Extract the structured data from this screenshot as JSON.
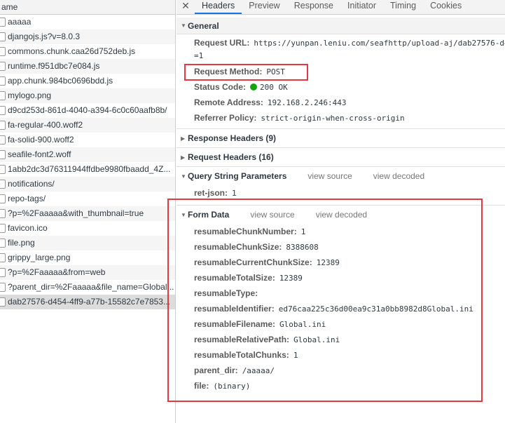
{
  "left": {
    "header": "ame",
    "requests": [
      "aaaaa",
      "djangojs.js?v=8.0.3",
      "commons.chunk.caa26d752deb.js",
      "runtime.f951dbc7e084.js",
      "app.chunk.984bc0696bdd.js",
      "mylogo.png",
      "d9cd253d-861d-4040-a394-6c0c60aafb8b/",
      "fa-regular-400.woff2",
      "fa-solid-900.woff2",
      "seafile-font2.woff",
      "1abb2dc3d76311944ffdbe9980fbaadd_4Z...",
      "notifications/",
      "repo-tags/",
      "?p=%2Faaaaa&with_thumbnail=true",
      "favicon.ico",
      "file.png",
      "grippy_large.png",
      "?p=%2Faaaaa&from=web",
      "?parent_dir=%2Faaaaa&file_name=Global...",
      "dab27576-d454-4ff9-a77b-15582c7e7853..."
    ]
  },
  "tabs": {
    "close": "✕",
    "items": [
      "Headers",
      "Preview",
      "Response",
      "Initiator",
      "Timing",
      "Cookies"
    ],
    "active": "Headers"
  },
  "general": {
    "title": "General",
    "request_url_label": "Request URL:",
    "request_url_value": "https://yunpan.leniu.com/seafhttp/upload-aj/dab27576-d4",
    "request_url_cont": "=1",
    "method_label": "Request Method:",
    "method_value": "POST",
    "status_label": "Status Code:",
    "status_value": "200 OK",
    "remote_label": "Remote Address:",
    "remote_value": "192.168.2.246:443",
    "referrer_label": "Referrer Policy:",
    "referrer_value": "strict-origin-when-cross-origin"
  },
  "response_headers": "Response Headers (9)",
  "request_headers": "Request Headers (16)",
  "query": {
    "title": "Query String Parameters",
    "view_source": "view source",
    "view_decoded": "view decoded",
    "key": "ret-json:",
    "value": "1"
  },
  "form": {
    "title": "Form Data",
    "view_source": "view source",
    "view_decoded": "view decoded",
    "fields": [
      {
        "k": "resumableChunkNumber:",
        "v": "1"
      },
      {
        "k": "resumableChunkSize:",
        "v": "8388608"
      },
      {
        "k": "resumableCurrentChunkSize:",
        "v": "12389"
      },
      {
        "k": "resumableTotalSize:",
        "v": "12389"
      },
      {
        "k": "resumableType:",
        "v": ""
      },
      {
        "k": "resumableIdentifier:",
        "v": "ed76caa225c36d00ea9c31a0bb8982d8Global.ini"
      },
      {
        "k": "resumableFilename:",
        "v": "Global.ini"
      },
      {
        "k": "resumableRelativePath:",
        "v": "Global.ini"
      },
      {
        "k": "resumableTotalChunks:",
        "v": "1"
      },
      {
        "k": "parent_dir:",
        "v": "/aaaaa/"
      },
      {
        "k": "file:",
        "v": "(binary)"
      }
    ]
  },
  "colors": {
    "highlight": "#e6393d",
    "status_ok": "#0ea50e",
    "tab_active": "#1a73e8"
  }
}
